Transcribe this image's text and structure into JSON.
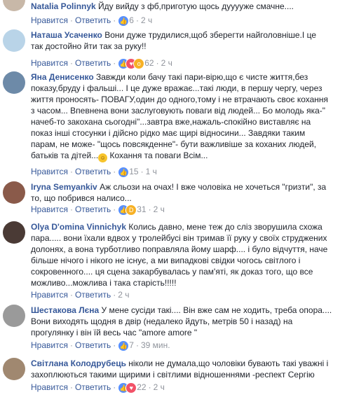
{
  "actions": {
    "like": "Нравится",
    "reply": "Ответить",
    "dot": "·"
  },
  "comments": [
    {
      "author": "Natalia Polinnyk",
      "text": "Йду вийду з фб,приготую щось дууууже смачне....",
      "reaction_count": "6",
      "time": "2 ч",
      "reactions": [
        "like"
      ]
    },
    {
      "author": "Наташа Усаченко",
      "text_lines": [
        "Вони дуже трудилися,щоб зберегти найголовніше.І це",
        "так достойно йти так за руку!!"
      ],
      "reaction_count": "62",
      "time": "2 ч",
      "reactions": [
        "like",
        "love",
        "wow"
      ]
    },
    {
      "author": "Яна Денисенко",
      "text_lines": [
        "Завжди коли бачу такі пари-вірю,що є чисте життя,без",
        "показу,бруду і фальші... І це дуже вражає...такі люди, в першу чергу, через",
        "життя проносять- ПОВАГУ,один до одного,тому і не втрачають своє кохання",
        "з часом... Впевнена вони заслуговують поваги від людей... Бо молодь яка-\"",
        "начеб-то закохана сьогодні\"...завтра вже,нажаль-спокійно виставляє на",
        "показ інші стосунки і дійсно рідко має щирі відносини... Завдяки таким",
        "парам, не може- \"щось повсякденне\"- бути важливіше за коханих людей,",
        "батьків та дітей..."
      ],
      "text_tail": "Кохання та поваги Всім...",
      "reaction_count": "15",
      "time": "1 ч",
      "reactions": [
        "like"
      ]
    },
    {
      "author": "Iryna Semyankiv",
      "text_lines": [
        "Аж сльози на очах! І вже чоловіка не хочеться \"гризти\", за",
        "то, що побрився налисо..."
      ],
      "reaction_count": "31",
      "time": "2 ч",
      "reactions": [
        "like",
        "haha"
      ]
    },
    {
      "author": "Olya D'omina Vinnichyk",
      "text_lines": [
        "Колись давно, мене теж до сліз зворушила схожа",
        "пара..... вони їхали вдвох у тролейбусі він тримав її руку у своїх струджених",
        "долонях, а вона турботливо поправляла йому шарф.... і було відчуття, наче",
        "більше нічого і нікого не існує, а ми випадкові свідки чогось світлого і",
        "сокровенного.... ця сцена закарбувалась у пам'яті, як доказ того, що все",
        "можливо...можлива і така старість!!!!!"
      ],
      "reaction_count": "",
      "time": "2 ч",
      "reactions": []
    },
    {
      "author": "Шестакова Лєна",
      "text_lines": [
        "У мене сусіди такі.... Він вже сам не ходить, треба опора....",
        "Вони виходять щодня в двір (недалеко йдуть, метрів 50 і назад) на",
        "прогулянку і він їй весь час \"amore amore \""
      ],
      "reaction_count": "7",
      "time": "39 мин.",
      "reactions": [
        "like"
      ]
    },
    {
      "author": "Світлана Колодрубець",
      "text_lines": [
        "ніколи не думала,що чоловіки бувають такі уважні і",
        "захоплюються такими щирими і світлими відношеннями -респект Сергію"
      ],
      "reaction_count": "22",
      "time": "2 ч",
      "reactions": [
        "like",
        "love"
      ]
    }
  ]
}
